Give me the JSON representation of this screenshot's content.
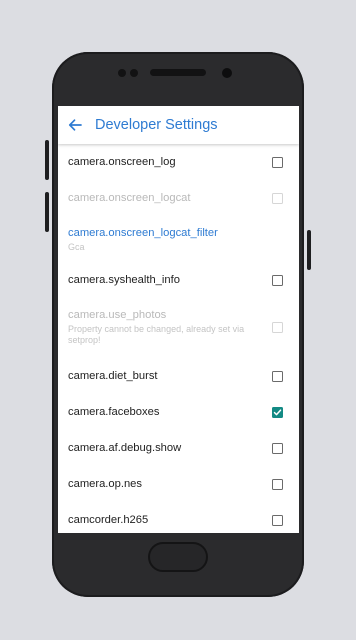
{
  "colors": {
    "accent": "#2e7bd2",
    "checkbox_checked": "#138a84",
    "device_body": "#2b2b2d",
    "background": "#dcdde2"
  },
  "appbar": {
    "back_icon": "arrow-left-icon",
    "title": "Developer Settings"
  },
  "settings": [
    {
      "label": "camera.onscreen_log",
      "state": "unchecked"
    },
    {
      "label": "camera.onscreen_logcat",
      "state": "disabled"
    },
    {
      "label": "camera.onscreen_logcat_filter",
      "summary": "Gca",
      "state": "none"
    },
    {
      "label": "camera.syshealth_info",
      "state": "unchecked"
    },
    {
      "label": "camera.use_photos",
      "summary": "Property cannot be changed, already set via setprop!",
      "state": "disabled"
    },
    {
      "label": "camera.diet_burst",
      "state": "unchecked"
    },
    {
      "label": "camera.faceboxes",
      "state": "checked"
    },
    {
      "label": "camera.af.debug.show",
      "state": "unchecked"
    },
    {
      "label": "camera.op.nes",
      "state": "unchecked"
    },
    {
      "label": "camcorder.h265",
      "state": "unchecked"
    }
  ]
}
